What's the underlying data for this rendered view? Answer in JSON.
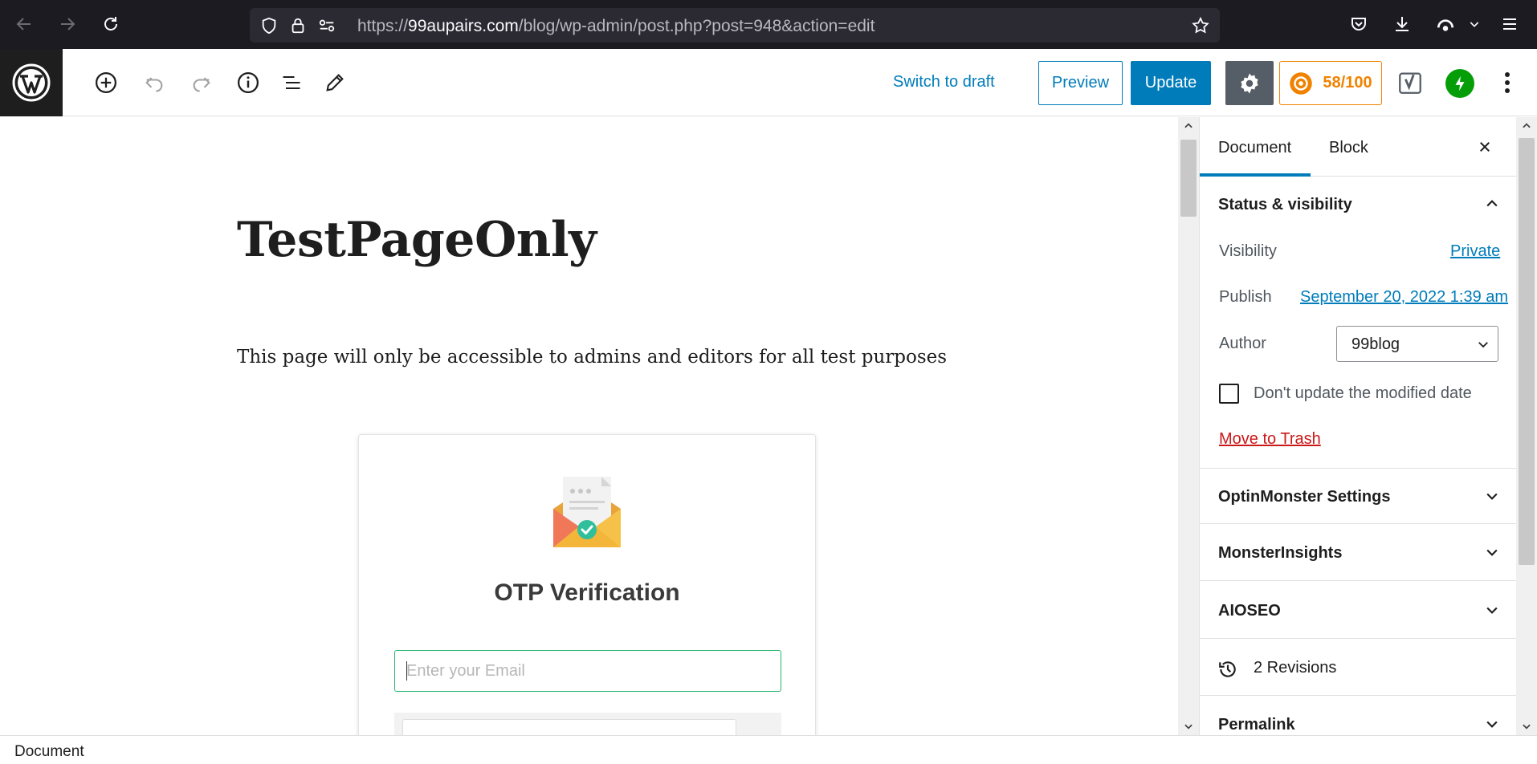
{
  "browser": {
    "url_prefix": "https://",
    "url_host": "99aupairs.com",
    "url_path": "/blog/wp-admin/post.php?post=948&action=edit"
  },
  "toolbar": {
    "switch_to_draft": "Switch to draft",
    "preview": "Preview",
    "update": "Update",
    "seo_score": "58/100"
  },
  "post": {
    "title": "TestPageOnly",
    "paragraph": "This page will only be accessible to admins and editors for all test purposes"
  },
  "otp": {
    "title": "OTP Verification",
    "email_placeholder": "Enter your Email"
  },
  "sidebar": {
    "tabs": [
      "Document",
      "Block"
    ],
    "status_visibility": {
      "title": "Status & visibility",
      "visibility_label": "Visibility",
      "visibility_value": "Private",
      "publish_label": "Publish",
      "publish_value": "September 20, 2022 1:39 am",
      "author_label": "Author",
      "author_value": "99blog",
      "dont_update_label": "Don't update the modified date",
      "move_to_trash": "Move to Trash"
    },
    "panels": [
      "OptinMonster Settings",
      "MonsterInsights",
      "AIOSEO"
    ],
    "revisions": "2 Revisions",
    "permalink": "Permalink"
  },
  "footer": {
    "breadcrumb": "Document"
  },
  "colors": {
    "accent": "#007cba",
    "seo_orange": "#f18200",
    "jetpack_green": "#069e08",
    "danger": "#cc1818"
  }
}
